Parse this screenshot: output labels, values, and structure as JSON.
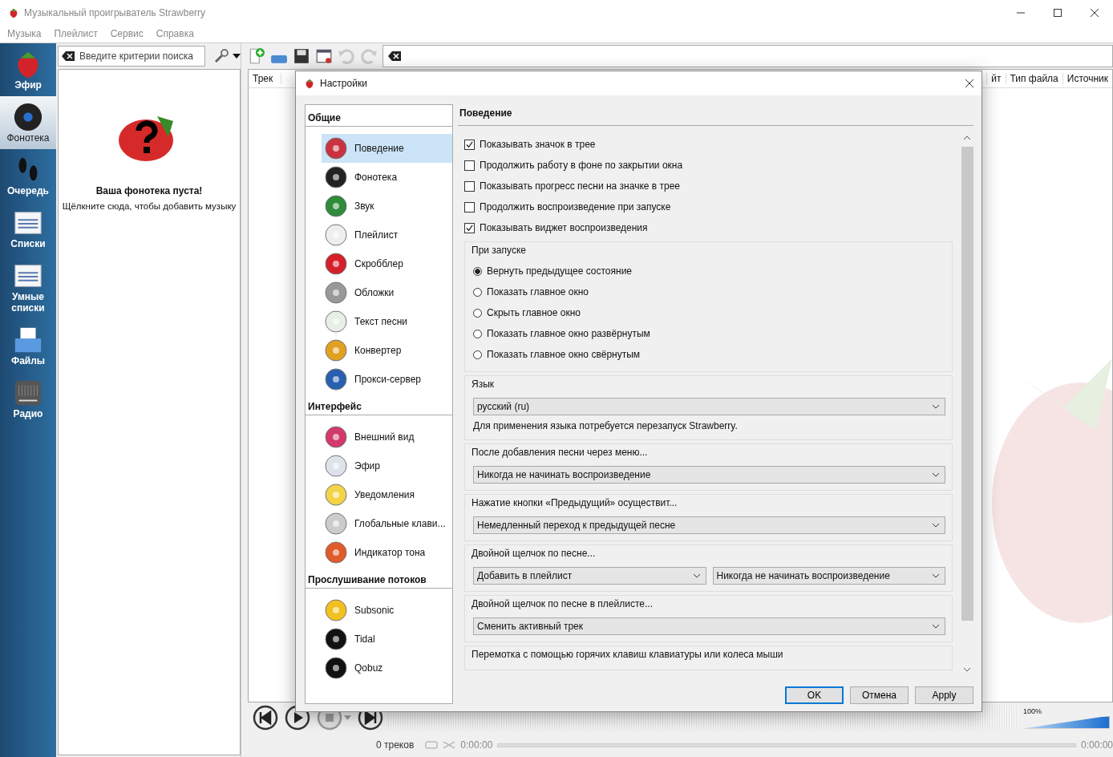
{
  "window": {
    "title": "Музыкальный проигрыватель Strawberry"
  },
  "menu": [
    "Музыка",
    "Плейлист",
    "Сервис",
    "Справка"
  ],
  "sidebar": {
    "items": [
      {
        "label": "Эфир",
        "selected": false
      },
      {
        "label": "Фонотека",
        "selected": true
      },
      {
        "label": "Очередь",
        "selected": false
      },
      {
        "label": "Списки",
        "selected": false
      },
      {
        "label": "Умные списки",
        "selected": false
      },
      {
        "label": "Файлы",
        "selected": false
      },
      {
        "label": "Радио",
        "selected": false
      }
    ]
  },
  "library": {
    "search_placeholder": "Введите критерии поиска",
    "empty_title": "Ваша фонотека пуста!",
    "empty_hint": "Щёлкните сюда, чтобы добавить музыку"
  },
  "playlist": {
    "columns": [
      "Трек",
      "йт",
      "Тип файла",
      "Источник"
    ]
  },
  "player": {
    "volume": {
      "reading": "100%",
      "level": 1
    }
  },
  "status_bar": {
    "track_count": "0 треков",
    "elapsed": "0:00:00",
    "seek": {
      "level": 0
    },
    "total": "0:00:00"
  },
  "dialog": {
    "title": "Настройки",
    "nav": [
      {
        "heading": "Общие",
        "items": [
          {
            "label": "Поведение",
            "selected": true
          },
          {
            "label": "Фонотека",
            "selected": false
          },
          {
            "label": "Звук",
            "selected": false
          },
          {
            "label": "Плейлист",
            "selected": false
          },
          {
            "label": "Скробблер",
            "selected": false
          },
          {
            "label": "Обложки",
            "selected": false
          },
          {
            "label": "Текст песни",
            "selected": false
          },
          {
            "label": "Конвертер",
            "selected": false
          },
          {
            "label": "Прокси-сервер",
            "selected": false
          }
        ]
      },
      {
        "heading": "Интерфейс",
        "items": [
          {
            "label": "Внешний вид",
            "selected": false
          },
          {
            "label": "Эфир",
            "selected": false
          },
          {
            "label": "Уведомления",
            "selected": false
          },
          {
            "label": "Глобальные клави...",
            "selected": false
          },
          {
            "label": "Индикатор тона",
            "selected": false
          }
        ]
      },
      {
        "heading": "Прослушивание потоков",
        "items": [
          {
            "label": "Subsonic",
            "selected": false
          },
          {
            "label": "Tidal",
            "selected": false
          },
          {
            "label": "Qobuz",
            "selected": false
          }
        ]
      }
    ],
    "page_title": "Поведение",
    "checkboxes": [
      {
        "label": "Показывать значок в трее",
        "checked": true
      },
      {
        "label": "Продолжить работу в фоне по закрытии окна",
        "checked": false
      },
      {
        "label": "Показывать прогресс песни на значке в трее",
        "checked": false
      },
      {
        "label": "Продолжить воспроизведение при запуске",
        "checked": false
      },
      {
        "label": "Показывать виджет воспроизведения",
        "checked": true
      }
    ],
    "startup": {
      "title": "При запуске",
      "options": [
        {
          "label": "Вернуть предыдущее состояние",
          "selected": true
        },
        {
          "label": "Показать главное окно",
          "selected": false
        },
        {
          "label": "Скрыть главное окно",
          "selected": false
        },
        {
          "label": "Показать главное окно развёрнутым",
          "selected": false
        },
        {
          "label": "Показать главное окно свёрнутым",
          "selected": false
        }
      ]
    },
    "groups": [
      {
        "title": "Язык",
        "dropdowns": [
          "русский (ru)"
        ],
        "note": "Для применения языка потребуется перезапуск Strawberry."
      },
      {
        "title": "После добавления песни через меню...",
        "dropdowns": [
          "Никогда не начинать воспроизведение"
        ]
      },
      {
        "title": "Нажатие кнопки «Предыдущий» осуществит...",
        "dropdowns": [
          "Немедленный переход к предыдущей песне"
        ]
      },
      {
        "title": "Двойной щелчок по песне...",
        "dropdowns": [
          "Добавить в плейлист",
          "Никогда не начинать воспроизведение"
        ]
      },
      {
        "title": "Двойной щелчок по песне в плейлисте...",
        "dropdowns": [
          "Сменить активный трек"
        ]
      },
      {
        "title": "Перемотка с помощью горячих клавиш клавиатуры или колеса мыши"
      }
    ],
    "buttons": [
      "OK",
      "Отмена",
      "Apply"
    ]
  }
}
